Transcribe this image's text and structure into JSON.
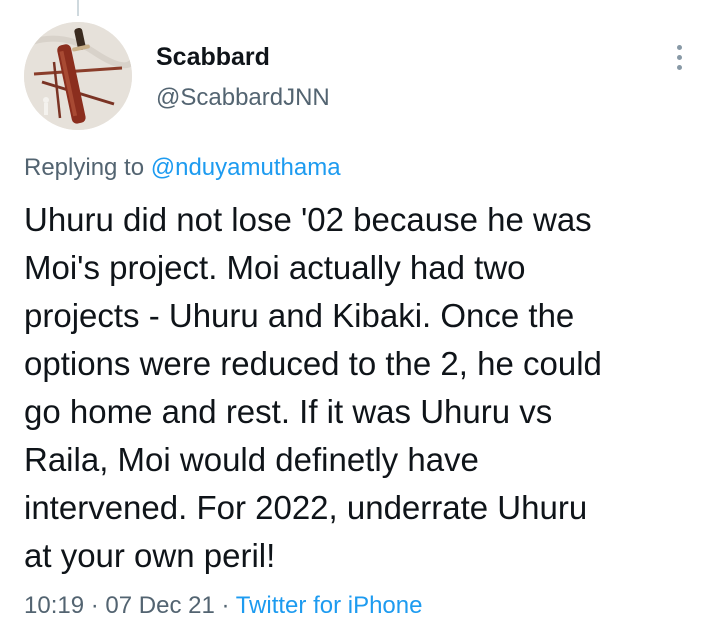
{
  "tweet": {
    "author_name": "Scabbard",
    "author_handle": "@ScabbardJNN",
    "replying_prefix": "Replying to",
    "replying_mention": "@nduyamuthama",
    "text_lines": [
      "Uhuru did not lose '02 because he was",
      "Moi's project. Moi actually had two",
      "projects - Uhuru and Kibaki. Once the",
      "options were reduced to the 2, he could",
      "go home and rest. If it was Uhuru vs",
      "Raila, Moi would definetly have",
      "intervened. For 2022, underrate Uhuru",
      "at your own peril!"
    ],
    "time": "10:19",
    "separator": "·",
    "date": "07 Dec 21",
    "source": "Twitter for iPhone"
  },
  "icons": {
    "more": "more-vertical-icon"
  },
  "colors": {
    "text": "#0f1419",
    "secondary": "#536471",
    "link": "#1d9bf0",
    "dots": "#8899a6"
  }
}
